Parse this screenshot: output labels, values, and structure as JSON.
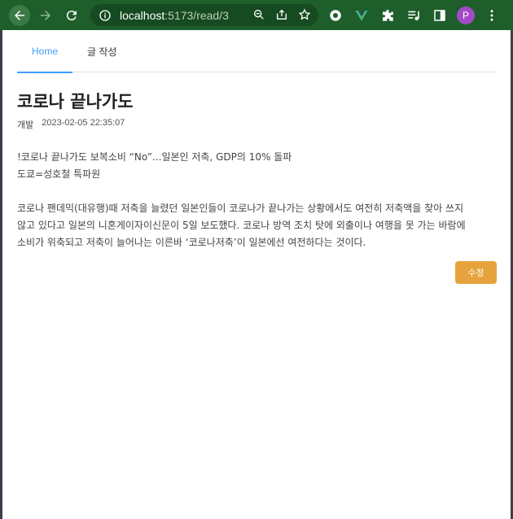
{
  "browser": {
    "url_host": "localhost",
    "url_rest": ":5173/read/3",
    "profile_initial": "P"
  },
  "nav": {
    "tabs": [
      {
        "label": "Home"
      },
      {
        "label": "글 작성"
      }
    ]
  },
  "post": {
    "title": "코로나 끝나가도",
    "category": "개발",
    "date": "2023-02-05 22:35:07",
    "lines": [
      "!코로나 끝나가도 보복소비 “No”...일본인 저축, GDP의 10% 돌파",
      "도쿄=성호철 특파원",
      "",
      "코로나 팬데믹(대유행)때 저축을 늘렸던 일본인들이 코로나가 끝나가는 상황에서도 여전히 저축액을 찾아 쓰지",
      "않고 있다고 일본의 니혼게이자이신문이 5일 보도했다. 코로나 방역 조치 탓에 외출이나 여행을 못 가는 바람에",
      "소비가 위축되고 저축이 늘어나는 이른바 ‘코로나저축’이 일본에선 여전하다는 것이다."
    ],
    "edit_label": "수정"
  },
  "colors": {
    "accent": "#409eff",
    "edit_button": "#e6a23c",
    "chrome": "#1e5e2a"
  }
}
